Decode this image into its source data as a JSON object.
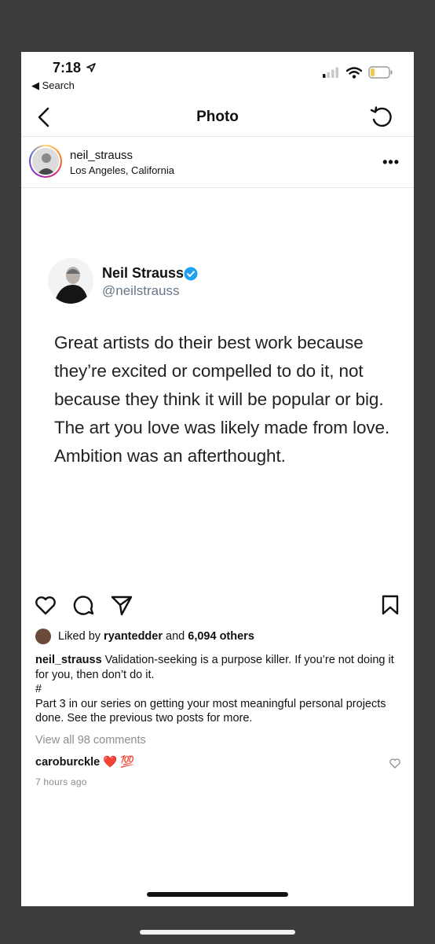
{
  "status_bar": {
    "time": "7:18",
    "back_label": "◀ Search"
  },
  "nav": {
    "title": "Photo"
  },
  "post": {
    "username": "neil_strauss",
    "location": "Los Angeles, California",
    "more": "•••"
  },
  "tweet": {
    "name": "Neil Strauss",
    "handle": "@neilstrauss",
    "text": "Great artists do their best work because they’re excited or compelled to do it, not because they think it will be popular or big. The art you love was likely made from love. Ambition was an afterthought."
  },
  "likes": {
    "prefix": "Liked by ",
    "liker": "ryantedder",
    "middle": " and ",
    "others": "6,094 others"
  },
  "caption": {
    "username": "neil_strauss",
    "line1": " Validation-seeking is a purpose killer. If you’re not doing it for you, then don’t do it.",
    "hash": "#",
    "line2": "Part 3 in our series on getting your most meaningful personal projects done. See the previous two posts for more."
  },
  "comments": {
    "view_all": "View all 98 comments",
    "first_user": "caroburckle",
    "first_text": "❤️ 💯",
    "time_ago": "7 hours ago"
  },
  "colors": {
    "verified": "#1da1f2",
    "muted": "#8e8e8e",
    "handle": "#657786"
  }
}
